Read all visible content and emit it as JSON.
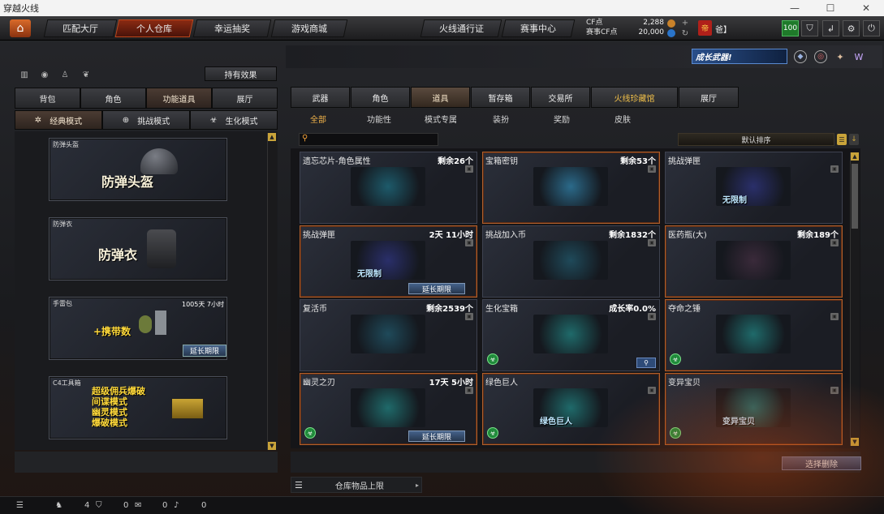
{
  "window": {
    "title": "穿越火线",
    "controls": [
      "—",
      "☐",
      "✕"
    ]
  },
  "topnav": {
    "tabs": [
      "匹配大厅",
      "个人仓库",
      "幸运抽奖",
      "游戏商城",
      "火线通行证",
      "赛事中心"
    ],
    "active_index": 1,
    "cf_label": "CF点",
    "cf_value": "2,288",
    "event_cf_label": "赛事CF点",
    "event_cf_value": "20,000",
    "user_level": "100",
    "user_name": "爸】"
  },
  "banner": {
    "text": "成长武器!"
  },
  "left": {
    "effect_button": "持有效果",
    "tabs": [
      "背包",
      "角色",
      "功能道具",
      "展厅"
    ],
    "active_tab": 2,
    "modes": [
      "经典模式",
      "挑战模式",
      "生化模式"
    ],
    "active_mode": 0,
    "cards": [
      {
        "label": "防弹头盔",
        "big": "防弹头盔",
        "timer": "",
        "extend": ""
      },
      {
        "label": "防弹衣",
        "big": "防弹衣",
        "timer": "",
        "extend": ""
      },
      {
        "label": "手雷包",
        "big": "+携带数",
        "timer": "1005天 7小时",
        "extend": "延长期限"
      },
      {
        "label": "C4工具箱",
        "big_lines": [
          "超级佣兵爆破",
          "间谍模式",
          "幽灵模式",
          "爆破模式"
        ],
        "timer": "",
        "extend": ""
      }
    ]
  },
  "right": {
    "tabs": [
      "武器",
      "角色",
      "道具",
      "暂存箱",
      "交易所",
      "火线珍藏馆",
      "展厅"
    ],
    "active_tab": 2,
    "subtabs": [
      "全部",
      "功能性",
      "模式专属",
      "装扮",
      "奖励",
      "皮肤"
    ],
    "active_subtab": 0,
    "search_placeholder": "",
    "sort_label": "默认排序",
    "items": [
      {
        "name": "遗忘芯片-角色属性",
        "right": "剩余26个",
        "hl": false,
        "ext": "",
        "green": false,
        "art": "#1d5a6a"
      },
      {
        "name": "宝箱密钥",
        "right": "剩余53个",
        "hl": true,
        "ext": "",
        "green": false,
        "art": "#2b6a8a"
      },
      {
        "name": "挑战弹匣",
        "right": "",
        "hl": false,
        "ext": "",
        "green": false,
        "art": "#2a2f6a",
        "overlay": "无限制"
      },
      {
        "name": "挑战弹匣",
        "right": "2天 11小时",
        "hl": true,
        "ext": "延长期限",
        "green": false,
        "art": "#2a2f6a",
        "overlay": "无限制"
      },
      {
        "name": "挑战加入币",
        "right": "剩余1832个",
        "hl": false,
        "ext": "",
        "green": false,
        "art": "#1f4a5a"
      },
      {
        "name": "医药瓶(大)",
        "right": "剩余189个",
        "hl": true,
        "ext": "",
        "green": false,
        "art": "#3a2a3a"
      },
      {
        "name": "复活币",
        "right": "剩余2539个",
        "hl": false,
        "ext": "",
        "green": false,
        "art": "#1f4a5a"
      },
      {
        "name": "生化宝箱",
        "right": "成长率0.0%",
        "hl": false,
        "ext": "",
        "green": true,
        "art": "#1f6a6a"
      },
      {
        "name": "夺命之锤",
        "right": "",
        "hl": true,
        "ext": "",
        "green": true,
        "art": "#1f6a6a"
      },
      {
        "name": "幽灵之刃",
        "right": "17天 5小时",
        "hl": true,
        "ext": "延长期限",
        "green": true,
        "art": "#1f6a6a"
      },
      {
        "name": "绿色巨人",
        "right": "",
        "hl": true,
        "ext": "",
        "green": true,
        "art": "#1f6a6a",
        "overlay": "绿色巨人"
      },
      {
        "name": "变异宝贝",
        "right": "",
        "hl": true,
        "ext": "",
        "green": true,
        "art": "#1f6a6a",
        "overlay": "变异宝贝"
      }
    ],
    "select_delete": "选择删除",
    "storage_limit": "仓库物品上限"
  },
  "status": {
    "count1": "4",
    "count2": "0",
    "count3": "0",
    "count4": "0"
  }
}
